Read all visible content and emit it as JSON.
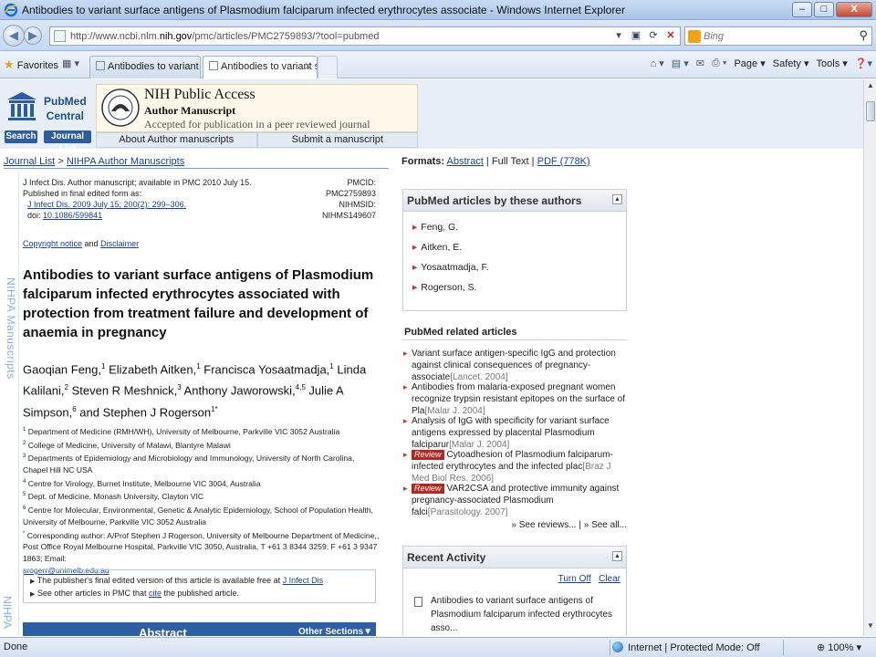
{
  "window": {
    "title": "Antibodies to variant surface antigens of Plasmodium falciparum infected erythrocytes associate - Windows Internet Explorer",
    "min": "–",
    "max": "□",
    "close": "X"
  },
  "address": {
    "url_prefix": "http://www.ncbi.nlm.",
    "url_host": "nih.gov",
    "url_suffix": "/pmc/articles/PMC2759893/?tool=pubmed",
    "search_placeholder": "Bing"
  },
  "favbar": {
    "favorites": "Favorites",
    "tabs": [
      {
        "label": "Antibodies to variant surfa..."
      },
      {
        "label": "Antibodies to variant s..."
      }
    ],
    "tab_close": "X",
    "commands": {
      "page": "Page ▾",
      "safety": "Safety ▾",
      "tools": "Tools ▾"
    }
  },
  "pmc": {
    "pubmed": "PubMed",
    "central": "Central",
    "search_btn": "Search",
    "journal_btn": "Journal List",
    "nih_title": "NIH Public Access",
    "nih_sub": "Author Manuscript",
    "nih_accepted": "Accepted for publication in a peer reviewed journal",
    "link_about": "About Author manuscripts",
    "link_submit": "Submit a manuscript"
  },
  "breadcrumb": {
    "journal_list": "Journal List",
    "sep": " > ",
    "nihpa": "NIHPA Author Manuscripts"
  },
  "formats": {
    "label": "Formats:",
    "abstract": "Abstract",
    "sep1": " | ",
    "full_text": "Full Text",
    "sep2": " | ",
    "pdf": "PDF (778K)"
  },
  "side": {
    "label": "NIHPA Manuscripts",
    "label2": "NIHPA"
  },
  "article": {
    "meta_line1": "J Infect Dis. Author manuscript; available in PMC 2010 July 15.",
    "meta_line2": "Published in final edited form as:",
    "meta_cite": "J Infect Dis. 2009 July 15; 200(2): 299–306.",
    "meta_doi_label": "doi:",
    "meta_doi": "10.1086/599841",
    "pmcid": "PMCID: PMC2759893",
    "nihmsid": "NIHMSID: NIHMS149607",
    "copyright": "Copyright notice",
    "and": " and ",
    "disclaimer": "Disclaimer",
    "title": "Antibodies to variant surface antigens of Plasmodium falciparum infected erythrocytes associated with protection from treatment failure and development of anaemia in pregnancy",
    "affiliations": [
      {
        "sup": "1",
        "text": "Department of Medicine (RMH/WH), University of Melbourne, Parkville VIC 3052 Australia"
      },
      {
        "sup": "2",
        "text": "College of Medicine, University of Malawi, Blantyre Malawi"
      },
      {
        "sup": "3",
        "text": "Departments of Epidemiology and Microbiology and Immunology, University of North Carolina, Chapel Hill NC USA"
      },
      {
        "sup": "4",
        "text": "Centre for Virology, Burnet Institute, Melbourne VIC 3004, Australia"
      },
      {
        "sup": "5",
        "text": "Dept. of Medicine, Monash University, Clayton VIC"
      },
      {
        "sup": "6",
        "text": "Centre for Molecular, Environmental, Genetic & Analytic Epidemiology, School of Population Health, University of Melbourne, Parkville VIC 3052 Australia"
      },
      {
        "sup": "*",
        "text": "Corresponding author: A/Prof Stephen J Rogerson, University of Melbourne Department of Medicine,, Post Office Royal Melbourne Hospital, Parkville VIC 3050, Australia, T +61 3 8344 3259; F +61 3 9347 1863; Email:"
      }
    ],
    "email": "srogerr@unimelb.edu.au",
    "notice1_pre": "The publisher's final edited version of this article is available free at ",
    "notice1_link": "J Infect Dis",
    "notice2_pre": "See other articles in PMC that ",
    "notice2_link": "cite",
    "notice2_post": " the published article.",
    "abstract_heading": "Abstract",
    "other_sections": "Other Sections▼"
  },
  "authors_box": {
    "heading": "PubMed articles by these authors",
    "items": [
      "Feng, G.",
      "Aitken, E.",
      "Yosaatmadja, F.",
      "Rogerson, S."
    ]
  },
  "related": {
    "heading": "PubMed related articles",
    "items": [
      {
        "review": "",
        "text": "Variant surface antigen-specific IgG and protection against clinical consequences of pregnancy-associate",
        "src": "[Lancet. 2004]"
      },
      {
        "review": "",
        "text": "Antibodies from malaria-exposed pregnant women recognize trypsin resistant epitopes on the surface of Pla",
        "src": "[Malar J. 2004]"
      },
      {
        "review": "",
        "text": "Analysis of IgG with specificity for variant surface antigens expressed by placental Plasmodium falciparur",
        "src": "[Malar J. 2004]"
      },
      {
        "review": "Review",
        "text": "Cytoadhesion of Plasmodium falciparum-infected erythrocytes and the infected plac",
        "src": "[Braz J Med Biol Res. 2006]"
      },
      {
        "review": "Review",
        "text": "VAR2CSA and protective immunity against pregnancy-associated Plasmodium falci",
        "src": "[Parasitology. 2007]"
      }
    ],
    "see_reviews": "» See reviews...",
    "sep": " | ",
    "see_all": "» See all..."
  },
  "recent": {
    "heading": "Recent Activity",
    "turn_off": "Turn Off",
    "clear": "Clear",
    "item": "Antibodies to variant surface antigens of Plasmodium falciparum infected erythrocytes asso..."
  },
  "status": {
    "done": "Done",
    "zone": "Internet | Protected Mode: Off",
    "zoom": "100%"
  }
}
